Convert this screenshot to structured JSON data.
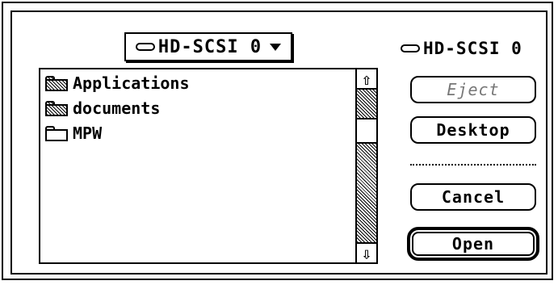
{
  "dialog": {
    "popup_label": "HD-SCSI 0",
    "volume_label": "HD-SCSI 0",
    "files": [
      {
        "name": "Applications",
        "icon": "folder-gray-icon"
      },
      {
        "name": "documents",
        "icon": "folder-gray-icon"
      },
      {
        "name": "MPW",
        "icon": "folder-icon"
      }
    ],
    "buttons": {
      "eject": "Eject",
      "desktop": "Desktop",
      "cancel": "Cancel",
      "open": "Open"
    }
  }
}
